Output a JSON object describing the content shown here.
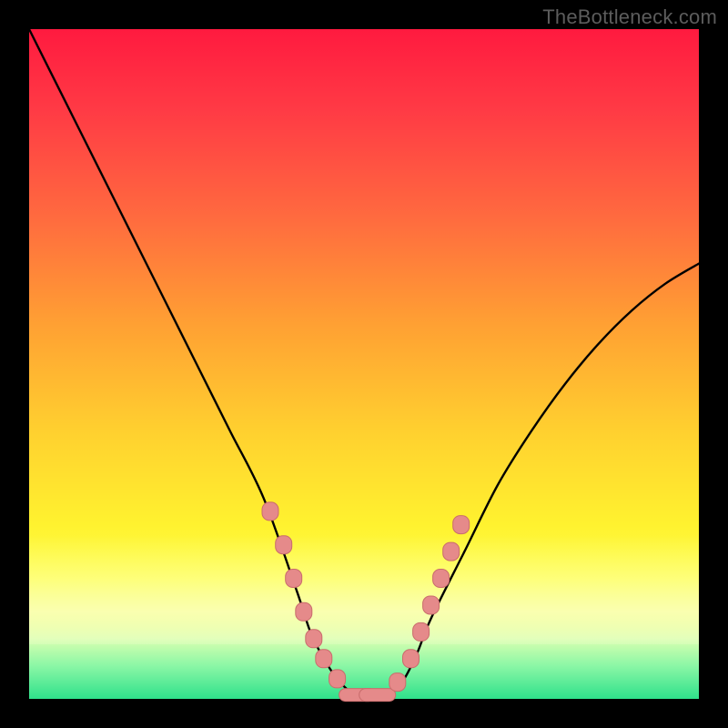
{
  "credit": "TheBottleneck.com",
  "colors": {
    "frame": "#000000",
    "curve": "#000000",
    "marker_fill": "#e58a8a",
    "marker_stroke": "#c96c6c",
    "gradient_top": "#ff1a3f",
    "gradient_bottom": "#2fe18b"
  },
  "chart_data": {
    "type": "line",
    "title": "",
    "xlabel": "",
    "ylabel": "",
    "xlim": [
      0,
      100
    ],
    "ylim": [
      0,
      100
    ],
    "series": [
      {
        "name": "bottleneck-curve",
        "x": [
          0,
          5,
          10,
          15,
          20,
          25,
          30,
          35,
          40,
          42,
          44,
          46,
          48,
          50,
          52,
          54,
          56,
          58,
          60,
          65,
          70,
          75,
          80,
          85,
          90,
          95,
          100
        ],
        "y": [
          100,
          90,
          80,
          70,
          60,
          50,
          40,
          30,
          16,
          10,
          6,
          3,
          1,
          0,
          0,
          1,
          3,
          7,
          12,
          22,
          32,
          40,
          47,
          53,
          58,
          62,
          65
        ]
      }
    ],
    "markers": {
      "name": "highlight-points",
      "shape": "rounded-rect",
      "points": [
        {
          "x": 36,
          "y": 28
        },
        {
          "x": 38,
          "y": 23
        },
        {
          "x": 39.5,
          "y": 18
        },
        {
          "x": 41,
          "y": 13
        },
        {
          "x": 42.5,
          "y": 9
        },
        {
          "x": 44,
          "y": 6
        },
        {
          "x": 46,
          "y": 3
        },
        {
          "x": 49,
          "y": 0.6,
          "wide": true
        },
        {
          "x": 52,
          "y": 0.6,
          "wide": true
        },
        {
          "x": 55,
          "y": 2.5
        },
        {
          "x": 57,
          "y": 6
        },
        {
          "x": 58.5,
          "y": 10
        },
        {
          "x": 60,
          "y": 14
        },
        {
          "x": 61.5,
          "y": 18
        },
        {
          "x": 63,
          "y": 22
        },
        {
          "x": 64.5,
          "y": 26
        }
      ]
    }
  }
}
